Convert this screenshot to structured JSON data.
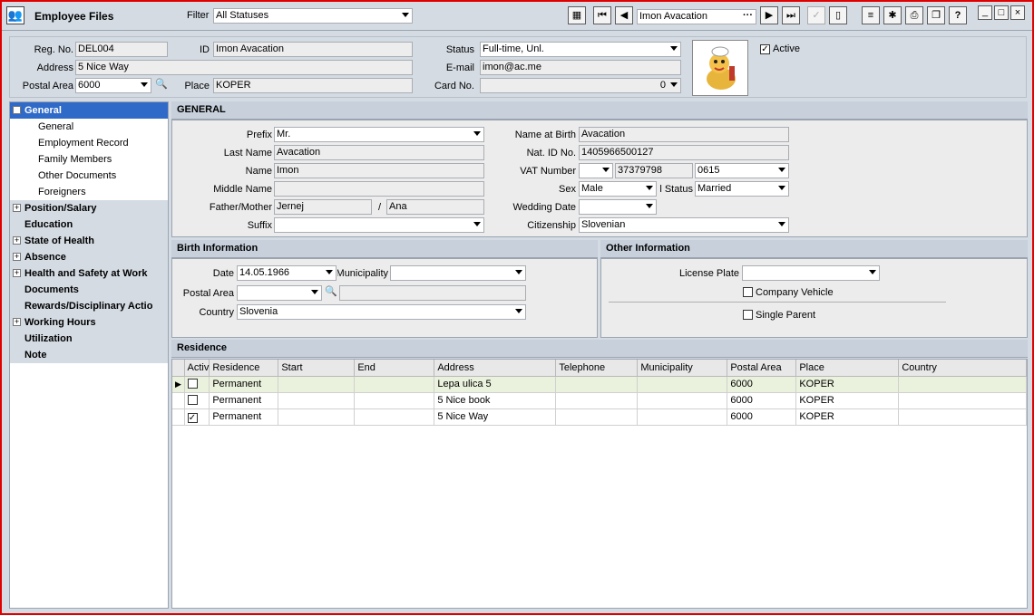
{
  "title": "Employee Files",
  "filter": {
    "label": "Filter",
    "value": "All Statuses"
  },
  "navigator": {
    "current": "Imon Avacation"
  },
  "header": {
    "reg_no_label": "Reg. No.",
    "reg_no": "DEL004",
    "id_label": "ID",
    "id": "Imon Avacation",
    "address_label": "Address",
    "address": "5 Nice Way",
    "postal_label": "Postal Area",
    "postal": "6000",
    "place_label": "Place",
    "place": "KOPER",
    "status_label": "Status",
    "status": "Full-time, Unl.",
    "email_label": "E-mail",
    "email": "imon@ac.me",
    "card_label": "Card No.",
    "card": "0",
    "active_label": "Active",
    "active": true
  },
  "nav": {
    "items": [
      {
        "label": "General",
        "expand": "-",
        "selected": true
      },
      {
        "label": "General",
        "sub": true
      },
      {
        "label": "Employment Record",
        "sub": true
      },
      {
        "label": "Family Members",
        "sub": true
      },
      {
        "label": "Other Documents",
        "sub": true
      },
      {
        "label": "Foreigners",
        "sub": true
      },
      {
        "label": "Position/Salary",
        "expand": "+"
      },
      {
        "label": "Education"
      },
      {
        "label": "State of Health",
        "expand": "+"
      },
      {
        "label": "Absence",
        "expand": "+"
      },
      {
        "label": "Health and Safety at Work",
        "expand": "+"
      },
      {
        "label": "Documents"
      },
      {
        "label": "Rewards/Disciplinary Actio"
      },
      {
        "label": "Working Hours",
        "expand": "+"
      },
      {
        "label": "Utilization"
      },
      {
        "label": "Note"
      }
    ]
  },
  "general": {
    "section_title": "GENERAL",
    "prefix_label": "Prefix",
    "prefix": "Mr.",
    "lastname_label": "Last Name",
    "lastname": "Avacation",
    "name_label": "Name",
    "name": "Imon",
    "middle_label": "Middle Name",
    "middle": "",
    "fm_label": "Father/Mother",
    "father": "Jernej",
    "slash": "/",
    "mother": "Ana",
    "suffix_label": "Suffix",
    "suffix": "",
    "birthname_label": "Name at Birth",
    "birthname": "Avacation",
    "natid_label": "Nat. ID No.",
    "natid": "1405966500127",
    "vat_label": "VAT Number",
    "vat_prefix": "",
    "vat": "37379798",
    "vat_suffix": "0615",
    "sex_label": "Sex",
    "sex": "Male",
    "marital_label": "l Status",
    "marital": "Married",
    "wedding_label": "Wedding Date",
    "wedding": "",
    "citizenship_label": "Citizenship",
    "citizenship": "Slovenian"
  },
  "birth": {
    "section_title": "Birth Information",
    "date_label": "Date",
    "date": "14.05.1966",
    "municipality_label": "Municipality",
    "municipality": "",
    "postal_label": "Postal Area",
    "postal": "",
    "postal_name": "",
    "country_label": "Country",
    "country": "Slovenia"
  },
  "other": {
    "section_title": "Other Information",
    "plate_label": "License Plate",
    "plate": "",
    "company_vehicle_label": "Company Vehicle",
    "single_parent_label": "Single Parent"
  },
  "residence": {
    "section_title": "Residence",
    "columns": [
      "Activ",
      "Residence",
      "Start",
      "End",
      "Address",
      "Telephone",
      "Municipality",
      "Postal Area",
      "Place",
      "Country"
    ],
    "rows": [
      {
        "active": false,
        "residence": "Permanent",
        "start": "",
        "end": "",
        "address": "Lepa ulica 5",
        "telephone": "",
        "municipality": "",
        "postal": "6000",
        "place": "KOPER",
        "country": "",
        "current": true
      },
      {
        "active": false,
        "residence": "Permanent",
        "start": "",
        "end": "",
        "address": "5 Nice book",
        "telephone": "",
        "municipality": "",
        "postal": "6000",
        "place": "KOPER",
        "country": ""
      },
      {
        "active": true,
        "residence": "Permanent",
        "start": "",
        "end": "",
        "address": "5 Nice Way",
        "telephone": "",
        "municipality": "",
        "postal": "6000",
        "place": "KOPER",
        "country": ""
      }
    ]
  },
  "icons": {
    "app": "employees-icon",
    "excel": "excel-export-icon",
    "first": "first-record-icon",
    "prev": "previous-record-icon",
    "next": "next-record-icon",
    "last": "last-record-icon",
    "confirm": "confirm-check-icon",
    "new": "new-document-icon",
    "edit": "edit-document-icon",
    "tools": "tools-icon",
    "print": "print-icon",
    "copy": "copy-icon",
    "help": "help-icon",
    "minimize": "minimize-icon",
    "maximize": "maximize-icon",
    "close": "close-icon",
    "search": "search-icon"
  },
  "colors": {
    "accent": "#2f6ac8",
    "frame": "#e00000",
    "panel": "#d4dbe3",
    "header": "#c7d0db",
    "selected_row": "#eaf1dc"
  }
}
